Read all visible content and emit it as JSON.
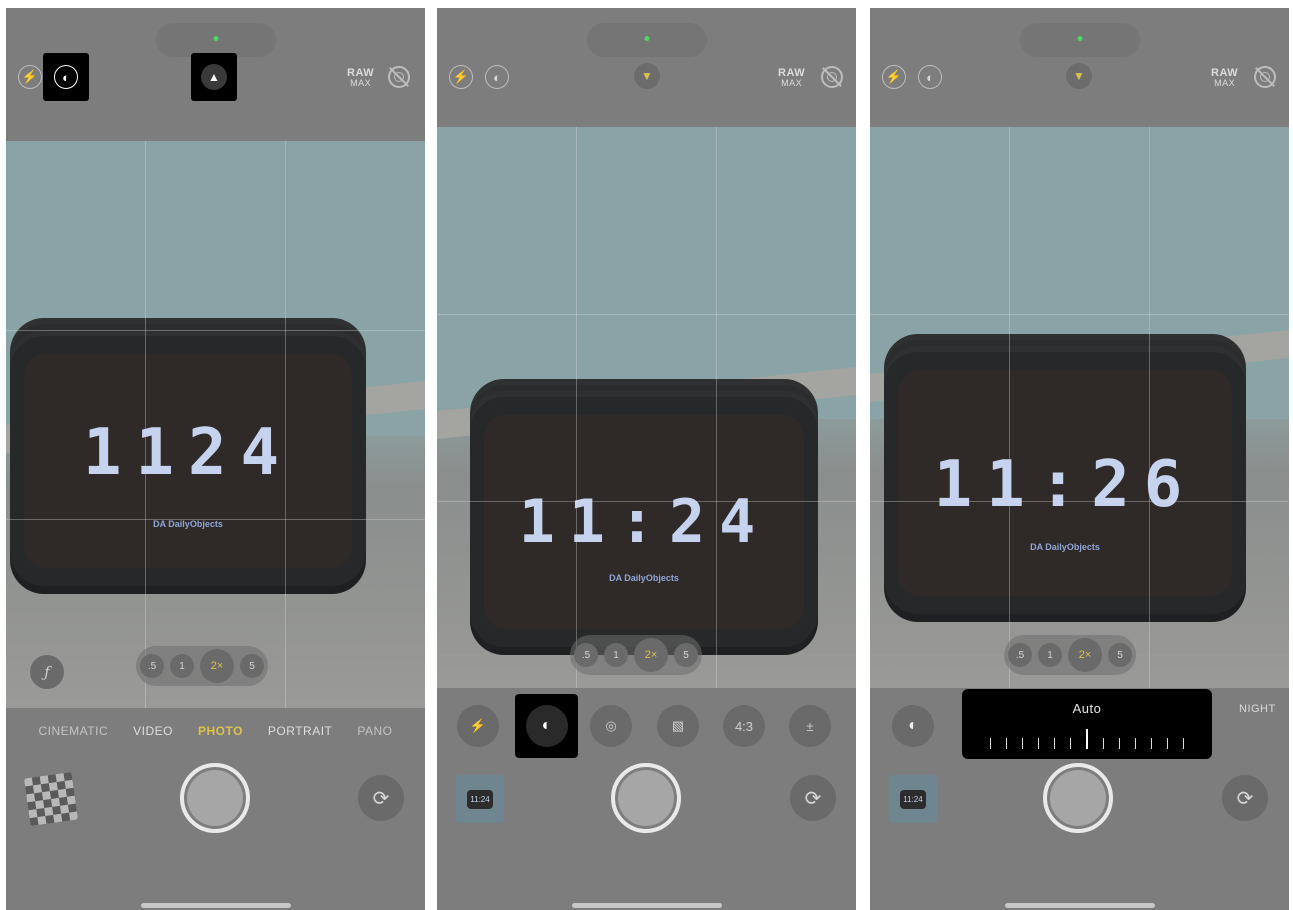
{
  "panels": [
    {
      "clock_time": "1124",
      "clock_brand": "DA DailyObjects",
      "modes": [
        "CINEMATIC",
        "VIDEO",
        "PHOTO",
        "PORTRAIT",
        "PANO"
      ],
      "selected_mode": "PHOTO",
      "raw": {
        "top": "RAW",
        "bottom": "MAX"
      },
      "zoom": [
        ".5",
        "1",
        "2×",
        "5"
      ],
      "selected_zoom": "2×",
      "f_label": "ƒ"
    },
    {
      "clock_time": "11:24",
      "clock_brand": "DA DailyObjects",
      "raw": {
        "top": "RAW",
        "bottom": "MAX"
      },
      "zoom": [
        ".5",
        "1",
        "2×",
        "5"
      ],
      "selected_zoom": "2×",
      "controls": {
        "flash": "⚡",
        "night": "◐",
        "live": "◎",
        "styles": "▧",
        "aspect": "4:3",
        "exposure": "±"
      },
      "thumb_time": "11:24"
    },
    {
      "clock_time": "11:26",
      "clock_brand": "DA DailyObjects",
      "raw": {
        "top": "RAW",
        "bottom": "MAX"
      },
      "zoom": [
        ".5",
        "1",
        "2×",
        "5"
      ],
      "selected_zoom": "2×",
      "exposure_label": "Auto",
      "night_label": "NIGHT",
      "thumb_time": "11:24"
    }
  ],
  "icons": {
    "flash": "flash-icon",
    "night_mode": "night-mode-icon",
    "chevron_up": "chevron-up-icon",
    "chevron_down": "chevron-down-icon",
    "live_photo": "live-photo-icon",
    "flip": "flip-camera-icon"
  },
  "colors": {
    "accent_yellow": "#e0c24a",
    "status_green": "#4fd46a",
    "highlight": "#000000"
  }
}
